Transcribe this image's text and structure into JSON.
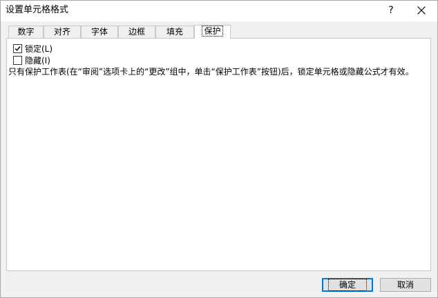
{
  "window": {
    "title": "设置单元格格式",
    "help_label": "?",
    "close_icon": "close-icon"
  },
  "tabs": [
    {
      "label": "数字",
      "active": false
    },
    {
      "label": "对齐",
      "active": false
    },
    {
      "label": "字体",
      "active": false
    },
    {
      "label": "边框",
      "active": false
    },
    {
      "label": "填充",
      "active": false
    },
    {
      "label": "保护",
      "active": true
    }
  ],
  "protection": {
    "locked": {
      "label": "锁定(L)",
      "checked": true
    },
    "hidden": {
      "label": "隐藏(I)",
      "checked": false
    },
    "description": "只有保护工作表(在“审阅”选项卡上的“更改”组中，单击“保护工作表”按钮)后，锁定单元格或隐藏公式才有效。"
  },
  "buttons": {
    "ok_label": "确定",
    "cancel_label": "取消"
  },
  "colors": {
    "default_button_border": "#0078d7",
    "panel_background": "#ffffff",
    "dialog_background": "#f0f0f0"
  }
}
